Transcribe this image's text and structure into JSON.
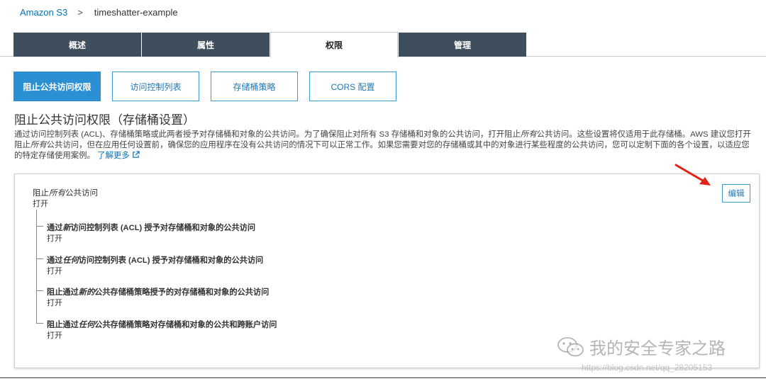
{
  "breadcrumb": {
    "root": "Amazon S3",
    "separator": ">",
    "bucket": "timeshatter-example"
  },
  "tabs": [
    {
      "label": "概述"
    },
    {
      "label": "属性"
    },
    {
      "label": "权限"
    },
    {
      "label": "管理"
    }
  ],
  "active_tab": "权限",
  "sub_buttons": [
    {
      "label": "阻止公共访问权限"
    },
    {
      "label": "访问控制列表"
    },
    {
      "label": "存储桶策略"
    },
    {
      "label": "CORS 配置"
    }
  ],
  "section": {
    "title": "阻止公共访问权限（存储桶设置）",
    "description_a": "通过访问控制列表 (ACL)、存储桶策略或此两者授予对存储桶和对象的公共访问。为了确保阻止对所有 S3 存储桶和对象的公共访问，打开阻止",
    "description_a_em": "所有",
    "description_b": "公共访问。这些设置将仅适用于此存储桶。AWS 建议您打开阻止",
    "description_b_em": "所有",
    "description_c": "公共访问，但在应用任何设置前，确保您的应用程序在没有公共访问的情况下可以正常工作。如果您需要对您的存储桶或其中的对象进行某些程度的公共访问，您可以定制下面的各个设置，以适应您的特定存储使用案例。",
    "learn_more": "了解更多",
    "external_link_icon": "external-link-icon"
  },
  "panel": {
    "main_title_prefix": "阻止",
    "main_title_em": "所有",
    "main_title_suffix": "公共访问",
    "main_value": "打开",
    "edit_label": "编辑",
    "settings": [
      {
        "prefix": "通过",
        "em": "新",
        "suffix": "访问控制列表 (ACL) 授予对存储桶和对象的公共访问",
        "value": "打开"
      },
      {
        "prefix": "通过",
        "em": "任何",
        "suffix": "访问控制列表 (ACL) 授予对存储桶和对象的公共访问",
        "value": "打开"
      },
      {
        "prefix": "阻止通过",
        "em": "新的",
        "suffix": "公共存储桶策略授予的对存储桶和对象的公共访问",
        "value": "打开"
      },
      {
        "prefix": "阻止通过",
        "em": "任何",
        "suffix": "公共存储桶策略对存储桶和对象的公共和跨账户访问",
        "value": "打开"
      }
    ]
  },
  "watermark": {
    "text": "我的安全专家之路",
    "url": "https://blog.csdn.net/qq_28205153"
  },
  "colors": {
    "tab_bg": "#3f4e5c",
    "accent": "#2b90d3",
    "link": "#0073bb",
    "arrow": "#e2231a"
  }
}
